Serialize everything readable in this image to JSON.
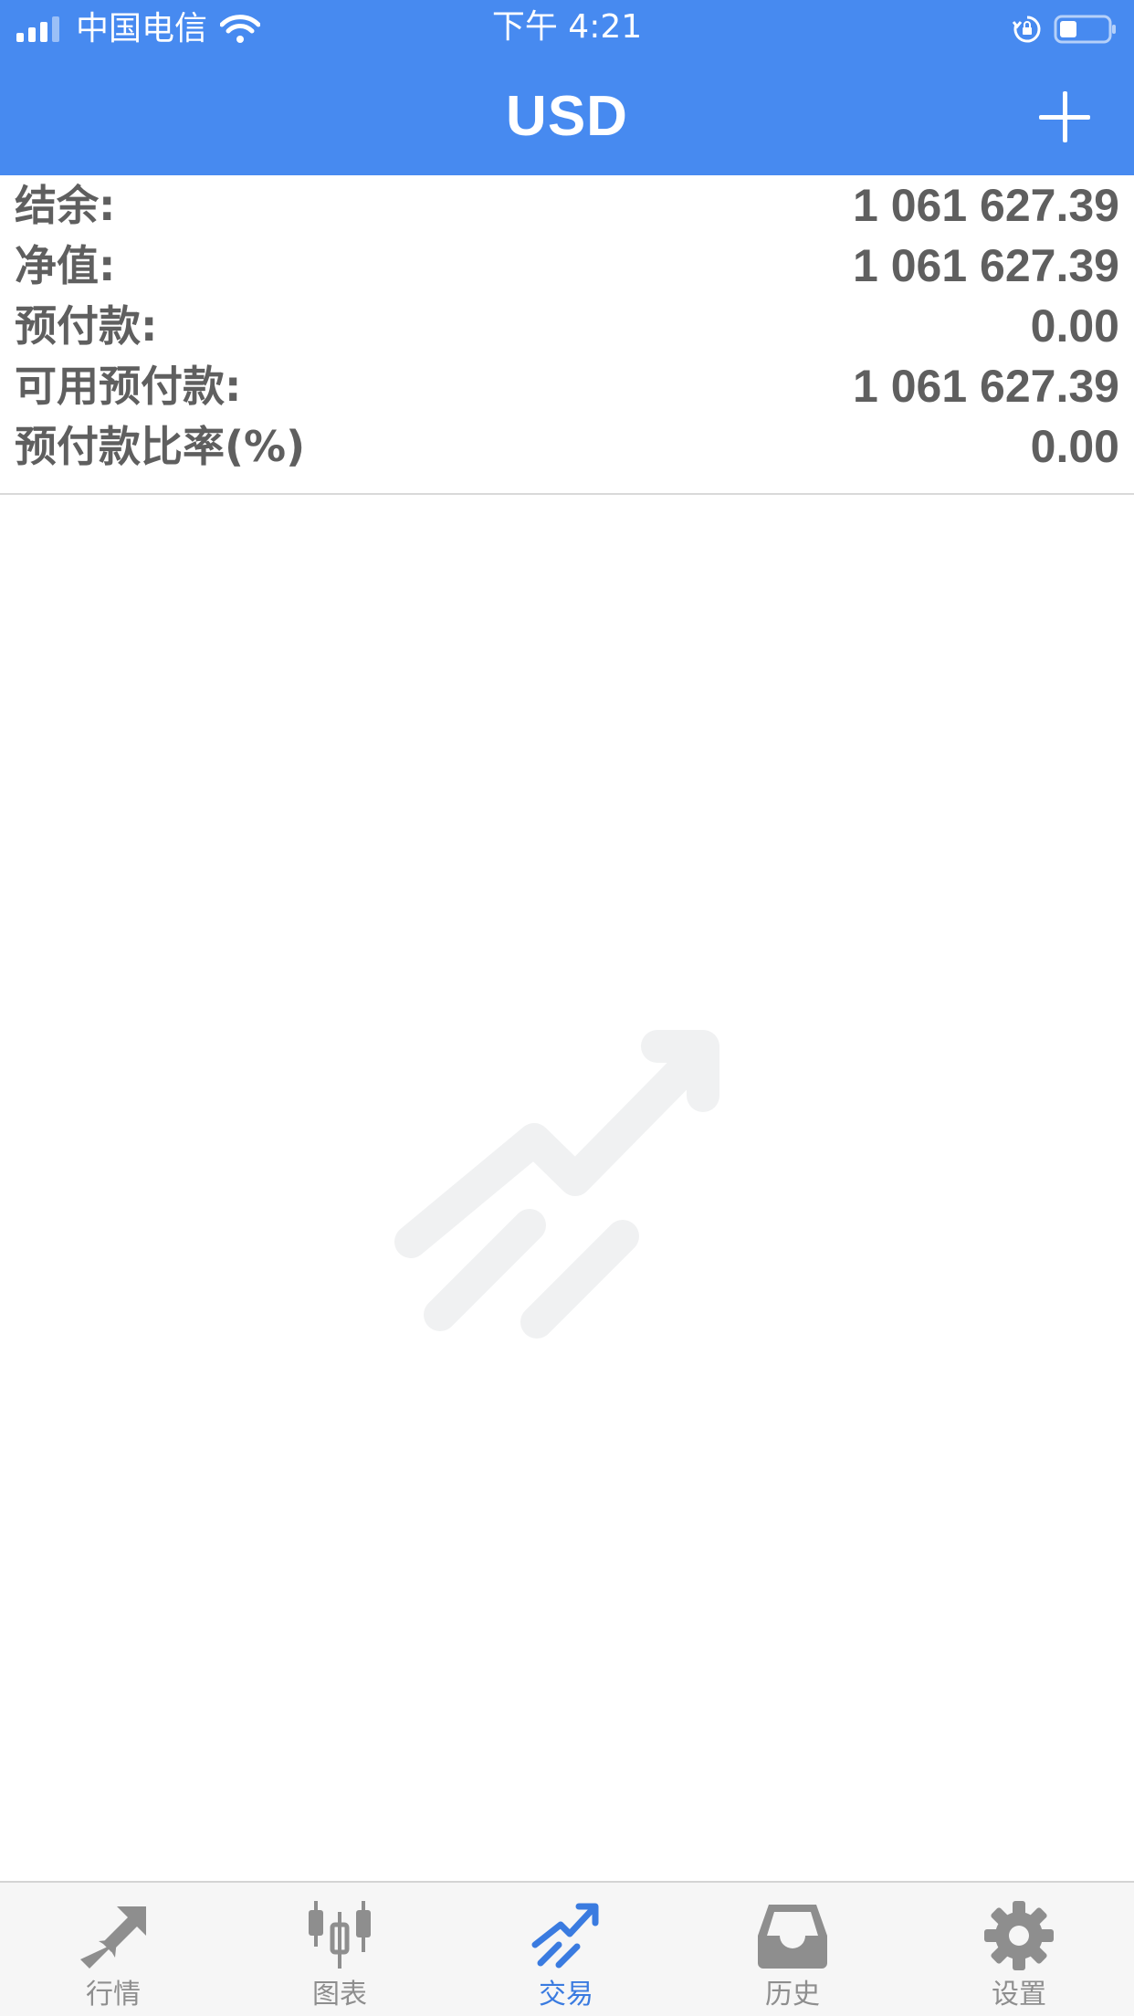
{
  "status_bar": {
    "carrier": "中国电信",
    "time": "下午 4:21"
  },
  "header": {
    "title": "USD"
  },
  "account_summary": [
    {
      "label": "结余:",
      "value": "1 061 627.39"
    },
    {
      "label": "净值:",
      "value": "1 061 627.39"
    },
    {
      "label": "预付款:",
      "value": "0.00"
    },
    {
      "label": "可用预付款:",
      "value": "1 061 627.39"
    },
    {
      "label": "预付款比率(%)",
      "value": "0.00"
    }
  ],
  "tabs": [
    {
      "label": "行情",
      "icon": "quotes-icon",
      "active": false
    },
    {
      "label": "图表",
      "icon": "chart-icon",
      "active": false
    },
    {
      "label": "交易",
      "icon": "trade-icon",
      "active": true
    },
    {
      "label": "历史",
      "icon": "history-icon",
      "active": false
    },
    {
      "label": "设置",
      "icon": "settings-icon",
      "active": false
    }
  ],
  "colors": {
    "accent": "#478af0",
    "active_tab": "#3a7be0",
    "inactive_tab": "#8e8e8e",
    "text": "#5f5f5f"
  }
}
